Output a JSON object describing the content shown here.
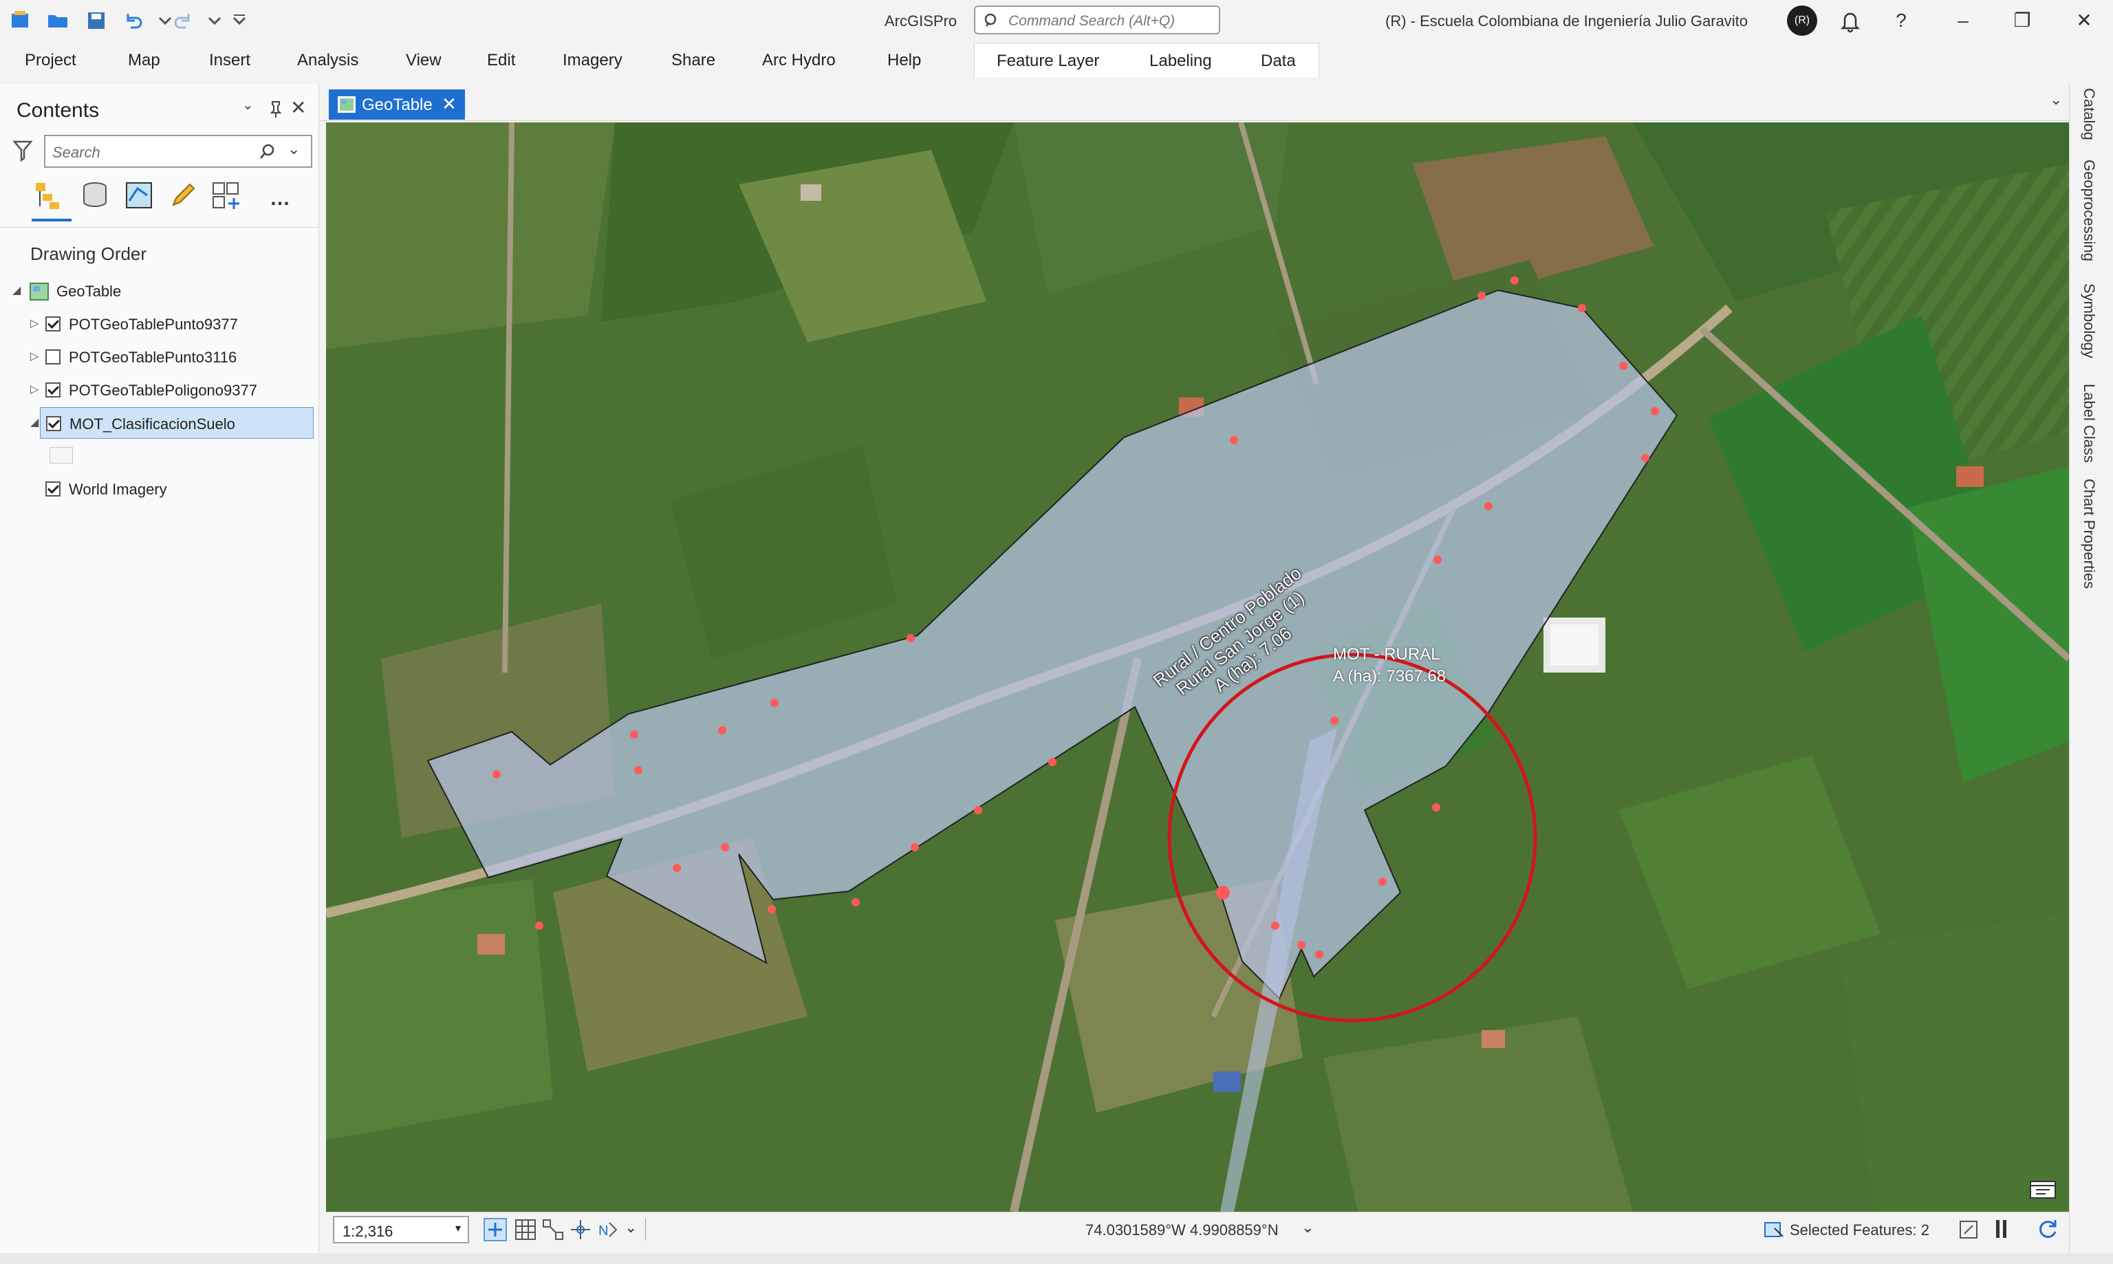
{
  "app": {
    "title": "ArcGISPro",
    "command_search_placeholder": "Command Search (Alt+Q)",
    "org_text": "(R) - Escuela Colombiana de Ingeniería Julio Garavito",
    "avatar_initials": "(R)"
  },
  "ribbon": {
    "tabs": [
      "Project",
      "Map",
      "Insert",
      "Analysis",
      "View",
      "Edit",
      "Imagery",
      "Share",
      "Arc Hydro",
      "Help"
    ],
    "contextual_tabs": [
      "Feature Layer",
      "Labeling",
      "Data"
    ]
  },
  "contents": {
    "title": "Contents",
    "search_placeholder": "Search",
    "drawing_order_label": "Drawing Order",
    "map_name": "GeoTable",
    "layers": [
      {
        "name": "POTGeoTablePunto9377",
        "checked": true
      },
      {
        "name": "POTGeoTablePunto3116",
        "checked": false
      },
      {
        "name": "POTGeoTablePoligono9377",
        "checked": true
      },
      {
        "name": "MOT_ClasificacionSuelo",
        "checked": true,
        "selected": true
      },
      {
        "name": "World Imagery",
        "checked": true
      }
    ]
  },
  "map": {
    "tab_label": "GeoTable",
    "label_polygon_line1": "Rural / Centro Poblado",
    "label_polygon_line2": "Rural San Jorge (1)",
    "label_polygon_line3": "A (ha): 7.06",
    "label_mot_line1": "MOT - RURAL",
    "label_mot_line2": "A (ha): 7367.68",
    "accent_color": "#1e6fd1",
    "highlight_circle_color": "#d4141b",
    "polygon_fill": "#b8c4e8"
  },
  "status": {
    "scale": "1:2,316",
    "coordinates": "74.0301589°W 4.9908859°N",
    "selected_features": "Selected Features: 2"
  },
  "right_dock": {
    "tabs": [
      "Catalog",
      "Geoprocessing",
      "Symbology",
      "Label Class",
      "Chart Properties"
    ]
  }
}
